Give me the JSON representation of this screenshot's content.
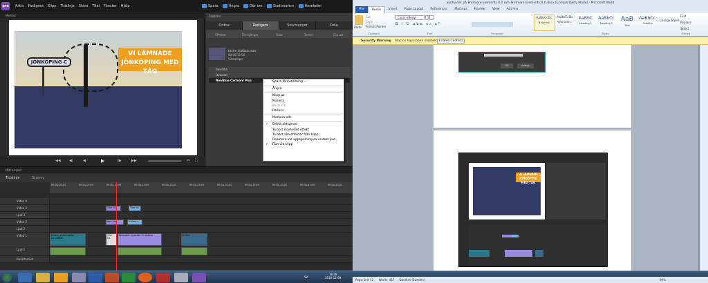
{
  "premiere": {
    "logo": "pre",
    "menu": [
      "Arkiv",
      "Redigera",
      "Klipp",
      "Tidslinje",
      "Skiva",
      "Titel",
      "Fönster",
      "Hjälp"
    ],
    "toolbar": {
      "save": "Spara",
      "undo": "Ångra",
      "redo": "Gör om",
      "capture": "Sceltmarkm",
      "help": "Hemkelm"
    },
    "monitor_title": "Monitor",
    "title_overlay": [
      "VI LÄMNADE",
      "JÖNKÖPING MED TÅG"
    ],
    "sign_text": "JÖNKÖPING C",
    "timecode": "00;00;17;00",
    "tasks_title": "Åtgärder",
    "tabs": [
      "Ordna",
      "Redigera",
      "Skivmenyer",
      "Dela"
    ],
    "subtabs": [
      "Effekter",
      "Övergångar",
      "Titlar",
      "Teman",
      "Clip art"
    ],
    "clip_name": "tmirre_stationn.mov",
    "clip_duration": "00;00;15;00",
    "clip_type": "Videoklipp",
    "effects": [
      "Bewölbe",
      "Opacitet",
      "NewBlue Cartoonr Plus"
    ],
    "context_menu": [
      {
        "label": "Spara förinställning ...",
        "state": ""
      },
      {
        "label": "sep"
      },
      {
        "label": "Ångra",
        "state": ""
      },
      {
        "label": "sep"
      },
      {
        "label": "Klipp ut",
        "state": ""
      },
      {
        "label": "Kopiera",
        "state": ""
      },
      {
        "label": "Klistra in",
        "state": "dis"
      },
      {
        "label": "Radera",
        "state": ""
      },
      {
        "label": "sep"
      },
      {
        "label": "Markera allt",
        "state": ""
      },
      {
        "label": "sep"
      },
      {
        "label": "Effekt aktiverad",
        "state": "chk"
      },
      {
        "label": "Ta bort markerad effekt",
        "state": ""
      },
      {
        "label": "Ta bort alla effekter från klipp",
        "state": ""
      },
      {
        "label": "Repetera vid uppspelning av endast ljud",
        "state": ""
      },
      {
        "label": "Fäst vid klipp",
        "state": "chk"
      }
    ],
    "timeline_title": "Mitt projekt",
    "timeline_tabs": [
      "Tidslinje",
      "Scenvy"
    ],
    "ruler": [
      "00;00;00;00",
      "00;00;05;00",
      "00;00;10;00",
      "00;00;15;00",
      "00;00;20;00",
      "00;00;25;00",
      "00;00;30;00",
      "00;00;35;00",
      "00;00;40;00",
      "00;00;45;00",
      "00;00;50;00"
    ],
    "tracks": [
      "Video 4",
      "Video 3",
      "Ljud 3",
      "Video 2",
      "Ljud 2",
      "Video 1",
      "Ljud 1",
      "Berättarröst"
    ],
    "clips_v3": [
      "Titel 01",
      "Titel 01"
    ],
    "clips_v2": [
      "mm_tag",
      "tmirre_s"
    ],
    "clips_v1": [
      "tmirre_stationsbild 02.CPANS",
      "Titel 01",
      "Spandelt Opacitet:Fri rökare",
      "tmirre"
    ]
  },
  "word": {
    "title": "Skillnader på Premiere Elements 8.0 och Premiere Elements 9.0.docx [Compatibility Mode] - Microsoft Word",
    "tabs": [
      "File",
      "Home",
      "Insert",
      "Page Layout",
      "References",
      "Mailings",
      "Review",
      "View",
      "Add-Ins"
    ],
    "clipboard": [
      "Cut",
      "Copy",
      "Format Painter"
    ],
    "paste": "Paste",
    "font": "Calibri (Body)",
    "size": "11",
    "styles": [
      {
        "sample": "AaBbCcDc",
        "name": "¶ Normal"
      },
      {
        "sample": "AaBbCcDc",
        "name": "¶ No Spaci..."
      },
      {
        "sample": "AaBbC",
        "name": "Heading 1"
      },
      {
        "sample": "AaBbCc",
        "name": "Heading 2"
      },
      {
        "sample": "AaB",
        "name": "Title"
      },
      {
        "sample": "AaBbCc.",
        "name": "Subtitle"
      }
    ],
    "change_styles": "Change Styles",
    "editing": [
      "Find",
      "Replace",
      "Select"
    ],
    "groups": [
      "Clipboard",
      "Font",
      "Paragraph",
      "Styles",
      "Editing"
    ],
    "security_title": "Security Warning",
    "security_msg": "Macros have been disabled.",
    "enable": "Enable Content",
    "dialog_ok": "OK",
    "dialog_cancel": "Avbryt",
    "status_page": "Page: 8 of 12",
    "status_words": "Words: 457",
    "status_lang": "Swedish (Sweden)",
    "zoom": "90%"
  },
  "taskbar": {
    "time": "18:36",
    "date": "2010-12-09",
    "lang": "SV"
  }
}
